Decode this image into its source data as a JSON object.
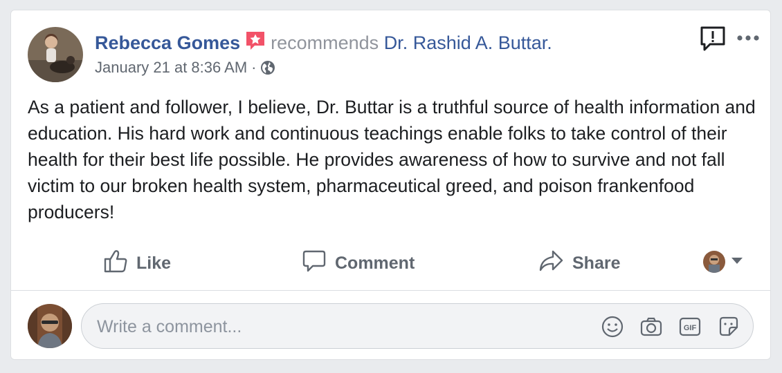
{
  "post": {
    "author": "Rebecca Gomes",
    "verb": "recommends",
    "recommended_page": "Dr. Rashid A. Buttar.",
    "timestamp": "January 21 at 8:36 AM",
    "separator": "·",
    "privacy_icon": "globe-icon",
    "text": "As a patient and follower, I believe, Dr. Buttar is a truthful source of health information and education. His hard work and continuous teachings enable folks to take control of their health for their best life possible. He provides awareness of how to survive and not fall victim to our broken health system, pharmaceutical greed, and poison frankenfood producers!"
  },
  "actions": {
    "like": "Like",
    "comment": "Comment",
    "share": "Share"
  },
  "comment_box": {
    "placeholder": "Write a comment..."
  },
  "icons": [
    "recommendation-badge-icon",
    "report-icon",
    "more-icon",
    "like-icon",
    "comment-icon",
    "share-icon",
    "chevron-down-icon",
    "emoji-icon",
    "camera-icon",
    "gif-icon",
    "sticker-icon",
    "globe-icon"
  ],
  "colors": {
    "link": "#365899",
    "secondary_text": "#606770",
    "badge": "#f25268",
    "background": "#e9ebee"
  }
}
